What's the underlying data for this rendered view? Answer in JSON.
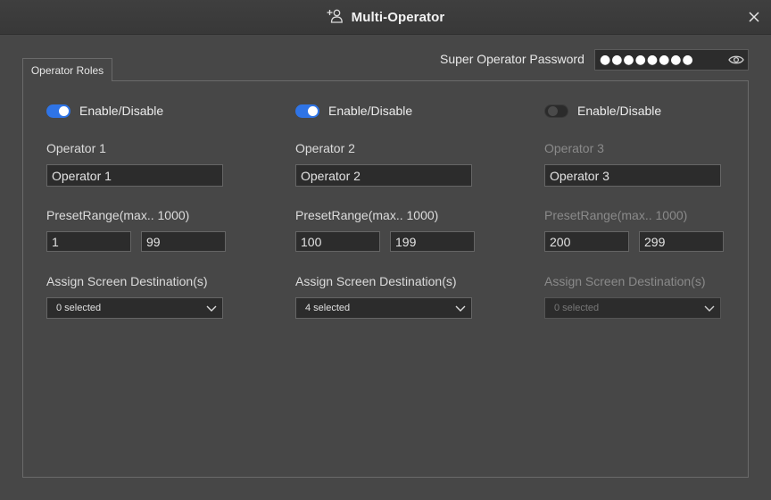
{
  "window": {
    "title": "Multi-Operator",
    "title_icon": "add-user-icon",
    "close_icon": "close-icon"
  },
  "password": {
    "label": "Super Operator Password",
    "value": "●●●●●●●●",
    "reveal_icon": "eye-icon"
  },
  "tabs": [
    {
      "label": "Operator Roles",
      "active": true
    }
  ],
  "operators": [
    {
      "enabled": true,
      "toggle_label": "Enable/Disable",
      "label": "Operator 1",
      "name_value": "Operator 1",
      "range_label": "PresetRange(max.. 1000)",
      "range_min": "1",
      "range_max": "99",
      "dest_label": "Assign Screen Destination(s)",
      "dest_value": "0 selected"
    },
    {
      "enabled": true,
      "toggle_label": "Enable/Disable",
      "label": "Operator 2",
      "name_value": "Operator 2",
      "range_label": "PresetRange(max.. 1000)",
      "range_min": "100",
      "range_max": "199",
      "dest_label": "Assign Screen Destination(s)",
      "dest_value": "4 selected"
    },
    {
      "enabled": false,
      "toggle_label": "Enable/Disable",
      "label": "Operator 3",
      "name_value": "Operator 3",
      "range_label": "PresetRange(max.. 1000)",
      "range_min": "200",
      "range_max": "299",
      "dest_label": "Assign Screen Destination(s)",
      "dest_value": "0 selected"
    }
  ],
  "colors": {
    "background": "#474747",
    "accent": "#2f74e6",
    "field": "#2c2c2c"
  }
}
